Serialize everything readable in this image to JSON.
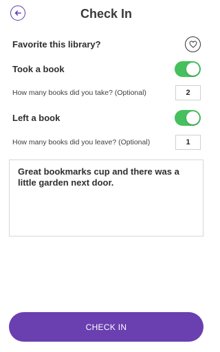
{
  "header": {
    "title": "Check In",
    "back_icon": "back-arrow-icon"
  },
  "favorite": {
    "label": "Favorite this library?",
    "icon": "heart-outline-icon"
  },
  "took": {
    "label": "Took a book",
    "toggle_on": true,
    "question": "How many books did you take? (Optional)",
    "count": "2"
  },
  "left": {
    "label": "Left a book",
    "toggle_on": true,
    "question": "How many books did you leave? (Optional)",
    "count": "1"
  },
  "notes": {
    "text": "Great bookmarks cup and there was a little garden next door."
  },
  "submit": {
    "label": "CHECK IN"
  },
  "colors": {
    "accent": "#6a3fb0",
    "toggle_on": "#45c05d"
  }
}
